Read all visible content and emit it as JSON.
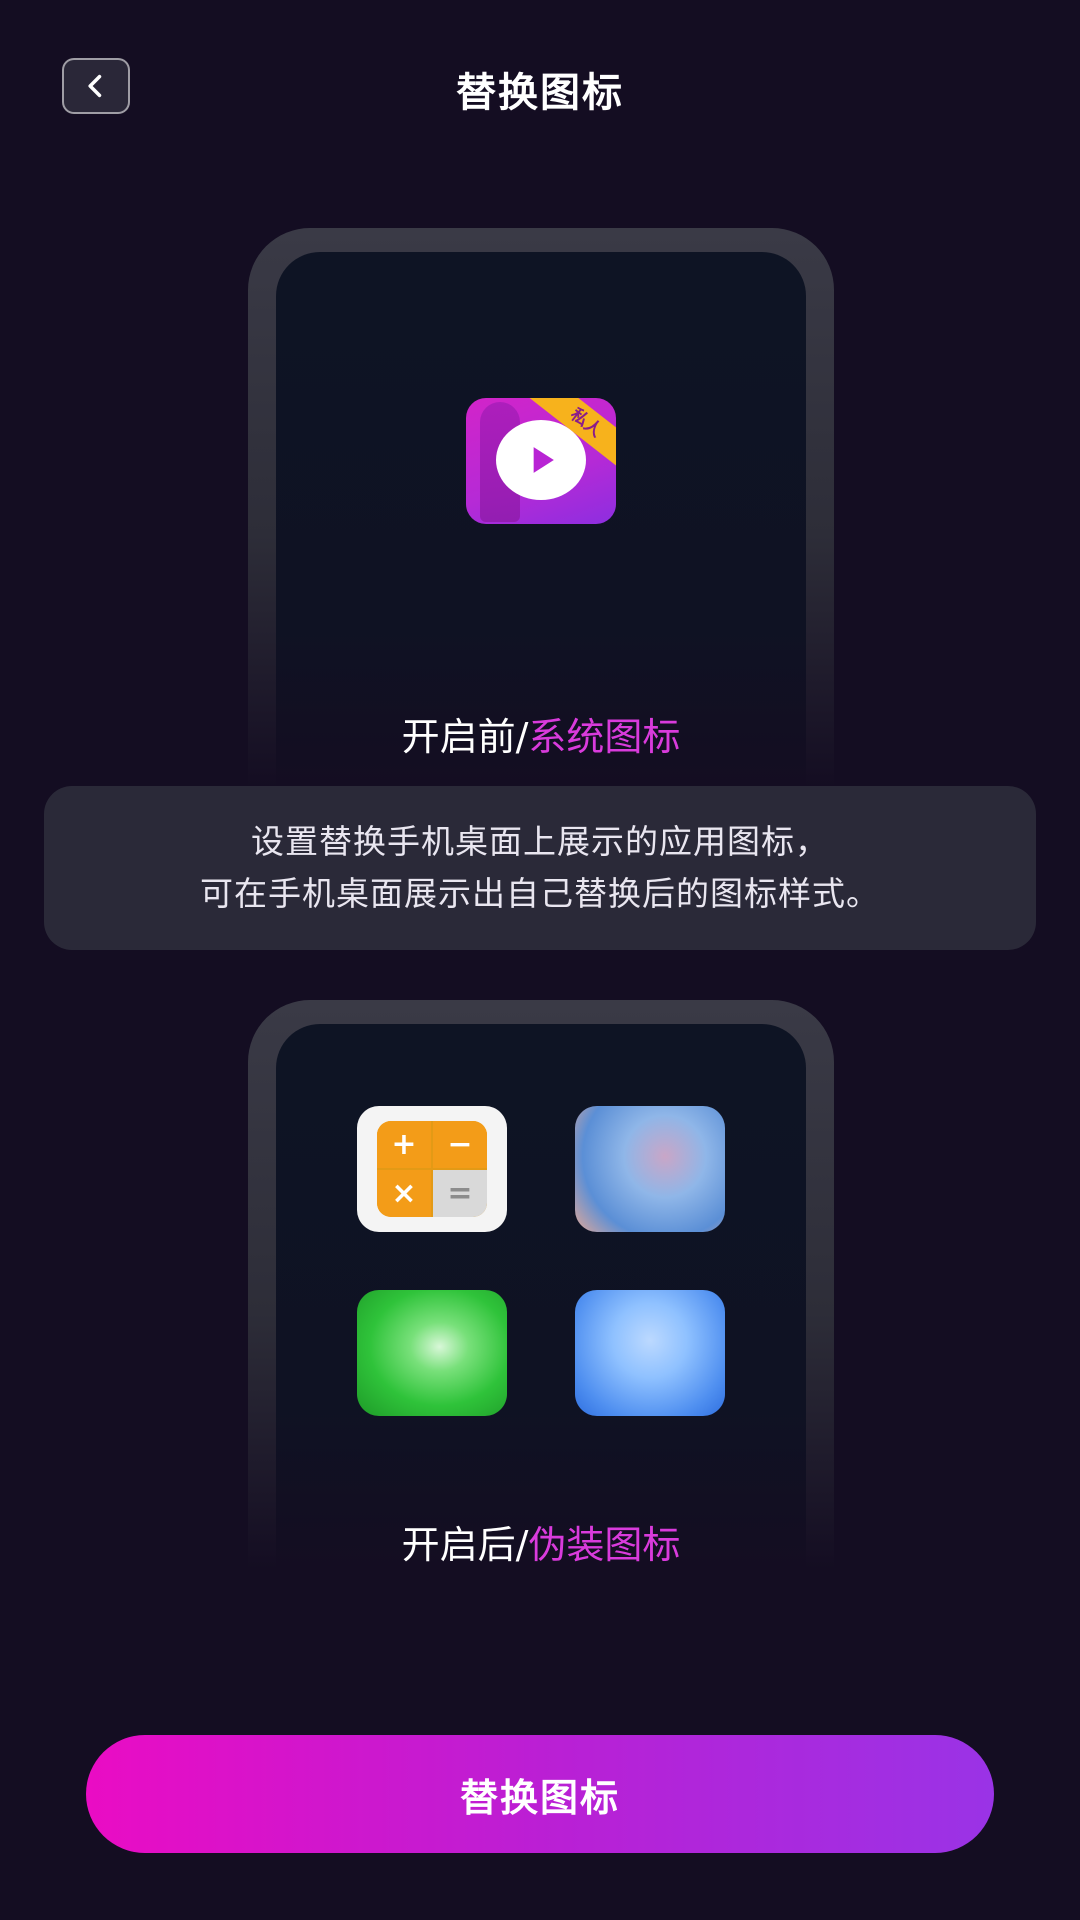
{
  "header": {
    "title": "替换图标",
    "back_icon": "chevron-left-icon"
  },
  "preview_before": {
    "caption_prefix": "开启前/",
    "caption_accent": "系统图标",
    "app_icon": {
      "name": "private-video-app-icon",
      "ribbon_text": "私人"
    }
  },
  "info": {
    "line1": "设置替换手机桌面上展示的应用图标，",
    "line2": "可在手机桌面展示出自己替换后的图标样式。"
  },
  "preview_after": {
    "caption_prefix": "开启后/",
    "caption_accent": "伪装图标",
    "icons": [
      {
        "name": "calculator-icon",
        "symbols": [
          "+",
          "−",
          "×",
          "="
        ]
      },
      {
        "name": "blurred-photo-icon"
      },
      {
        "name": "green-app-icon"
      },
      {
        "name": "blue-app-icon"
      }
    ]
  },
  "cta": {
    "label": "替换图标"
  },
  "colors": {
    "background": "#140d22",
    "accent": "#d93bdc",
    "cta_gradient_start": "#ea0cc4",
    "cta_gradient_end": "#9a33e6"
  }
}
